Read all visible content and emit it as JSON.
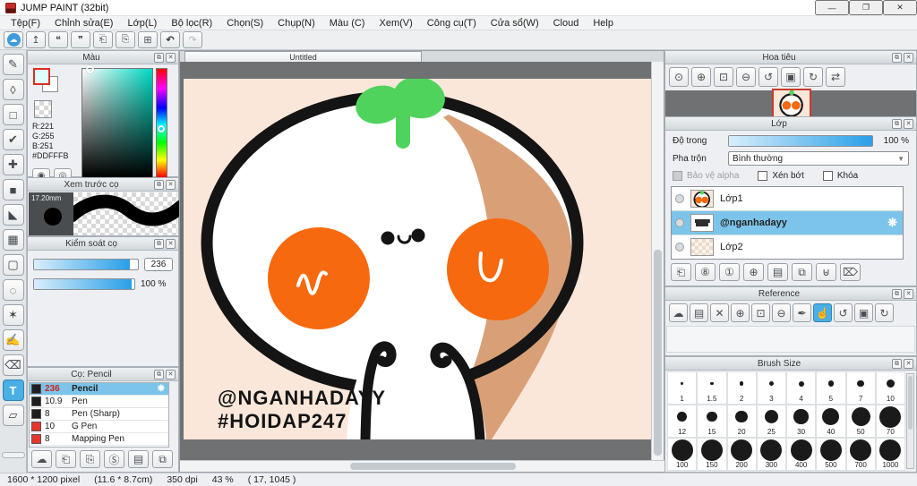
{
  "colors": {
    "artboard": "#FBE7DA",
    "outline": "#141414",
    "cheek": "#F7690E",
    "tan": "#D9A078",
    "sprout": "#4FD35C",
    "accent": "#49AFE4"
  },
  "window": {
    "title": "JUMP PAINT (32bit)",
    "controls": [
      {
        "name": "minimize-button",
        "glyph": "—"
      },
      {
        "name": "maximize-restore-button",
        "glyph": "❐"
      },
      {
        "name": "close-button",
        "glyph": "✕"
      }
    ]
  },
  "menu": {
    "items": [
      {
        "id": "menu-item-file",
        "label": "Tệp(F)"
      },
      {
        "id": "menu-item-edit",
        "label": "Chỉnh sửa(E)"
      },
      {
        "id": "menu-item-layer",
        "label": "Lớp(L)"
      },
      {
        "id": "menu-item-filter",
        "label": "Bộ lọc(R)"
      },
      {
        "id": "menu-item-select",
        "label": "Chọn(S)"
      },
      {
        "id": "menu-item-snap",
        "label": "Chụp(N)"
      },
      {
        "id": "menu-item-color",
        "label": "Màu (C)"
      },
      {
        "id": "menu-item-view",
        "label": "Xem(V)"
      },
      {
        "id": "menu-item-tools",
        "label": "Công cụ(T)"
      },
      {
        "id": "menu-item-window",
        "label": "Cửa sổ(W)"
      },
      {
        "id": "menu-item-cloud",
        "label": "Cloud"
      },
      {
        "id": "menu-item-help",
        "label": "Help"
      }
    ]
  },
  "toolbar": {
    "buttons": [
      {
        "name": "cloud-sync-button",
        "glyph": "☁",
        "blue": true
      },
      {
        "name": "publish-button",
        "glyph": "↥"
      },
      {
        "name": "comment-button",
        "glyph": "❝"
      },
      {
        "name": "comment-list-button",
        "glyph": "❞"
      },
      {
        "name": "document-button",
        "glyph": "⎗"
      },
      {
        "name": "document-settings-button",
        "glyph": "⎘"
      },
      {
        "name": "canvas-grid-button",
        "glyph": "⊞"
      },
      {
        "name": "undo-button",
        "glyph": "↶",
        "dark": true
      },
      {
        "name": "redo-button",
        "glyph": "↷",
        "muted": true
      }
    ]
  },
  "tools": {
    "items": [
      {
        "name": "brush-tool",
        "glyph": "✎"
      },
      {
        "name": "eraser-tool",
        "glyph": "◊"
      },
      {
        "name": "shape-brush-tool",
        "glyph": "□"
      },
      {
        "name": "control-point-tool",
        "glyph": "✔"
      },
      {
        "name": "move-tool",
        "glyph": "✚"
      },
      {
        "name": "fill-rect-tool",
        "glyph": "■"
      },
      {
        "name": "bucket-tool",
        "glyph": "◣"
      },
      {
        "name": "gradient-tool",
        "glyph": "▦"
      },
      {
        "name": "select-rect-tool",
        "glyph": "▢"
      },
      {
        "name": "lasso-tool",
        "glyph": "◌"
      },
      {
        "name": "magic-wand-tool",
        "glyph": "✶"
      },
      {
        "name": "select-pen-tool",
        "glyph": "✍"
      },
      {
        "name": "select-eraser-tool",
        "glyph": "⌫"
      },
      {
        "name": "text-tool",
        "glyph": "T",
        "active": true
      },
      {
        "name": "operation-tool",
        "glyph": "▱"
      }
    ]
  },
  "color_panel": {
    "title": "Màu",
    "r": "R:221",
    "g": "G:255",
    "b": "B:251",
    "hex": "#DDFFFB",
    "foreground": "#DDFFFB",
    "buttons": [
      {
        "name": "color-wheel-button",
        "glyph": "◉"
      },
      {
        "name": "color-compact-button",
        "glyph": "◎"
      }
    ]
  },
  "brush_preview": {
    "title": "Xem trước cọ",
    "size_label": "17.20mm"
  },
  "brush_control": {
    "title": "Kiểm soát cọ",
    "size_value": "236",
    "size_fill": "92%",
    "opacity_value": "100 %",
    "opacity_fill": "97%"
  },
  "brush_panel": {
    "title": "Cọ: Pencil",
    "brushes": [
      {
        "row": "brush-row-pencil",
        "size": "236",
        "name": "Pencil",
        "swatch": "#1E1E1E",
        "selected": true,
        "red_size": true,
        "gear": "❋"
      },
      {
        "row": "brush-row-pen",
        "size": "10.9",
        "name": "Pen",
        "swatch": "#1E1E1E"
      },
      {
        "row": "brush-row-pen-sharp",
        "size": "8",
        "name": "Pen (Sharp)",
        "swatch": "#1E1E1E"
      },
      {
        "row": "brush-row-g-pen",
        "size": "10",
        "name": "G Pen",
        "swatch": "#E8352B"
      },
      {
        "row": "brush-row-mapping-pen",
        "size": "8",
        "name": "Mapping Pen",
        "swatch": "#E8352B"
      }
    ],
    "footer": [
      {
        "name": "cloud-brush-button",
        "glyph": "☁"
      },
      {
        "name": "add-brush-button",
        "glyph": "⎗"
      },
      {
        "name": "add-brush-menu-button",
        "glyph": "⎘"
      },
      {
        "name": "script-brush-button",
        "glyph": "Ⓢ"
      },
      {
        "name": "brush-folder-button",
        "glyph": "▤"
      },
      {
        "name": "duplicate-brush-button",
        "glyph": "⧉"
      }
    ]
  },
  "canvas": {
    "tab": "Untitled",
    "watermark_line1": "@NGANHADAYY",
    "watermark_line2": "#HOIDAP247"
  },
  "navigator": {
    "title": "Hoa tiêu",
    "buttons": [
      {
        "name": "zoom-actual-button",
        "glyph": "⊙"
      },
      {
        "name": "zoom-in-button",
        "glyph": "⊕"
      },
      {
        "name": "zoom-fit-button",
        "glyph": "⊡"
      },
      {
        "name": "zoom-out-button",
        "glyph": "⊖"
      },
      {
        "name": "rotate-left-button",
        "glyph": "↺"
      },
      {
        "name": "rotate-reset-button",
        "glyph": "▣"
      },
      {
        "name": "rotate-right-button",
        "glyph": "↻"
      },
      {
        "name": "flip-horizontal-button",
        "glyph": "⇄"
      }
    ]
  },
  "layers_panel": {
    "title": "Lớp",
    "opacity_label": "Độ trong",
    "opacity_value": "100 %",
    "opacity_fill": "100%",
    "blend_label": "Pha trộn",
    "blend_value": "Bình thường",
    "cb_alpha": "Bảo vệ alpha",
    "cb_clip": "Xén bớt",
    "cb_lock": "Khóa",
    "layers": [
      {
        "row": "layer-row-lop1",
        "name": "Lớp1",
        "thumb": "face"
      },
      {
        "row": "layer-row-nganhadayy",
        "name": "@nganhadayy",
        "thumb": "text",
        "selected": true,
        "gear": "❋"
      },
      {
        "row": "layer-row-lop2",
        "name": "Lớp2",
        "thumb": "checker"
      }
    ],
    "footer": [
      {
        "name": "add-layer-button",
        "glyph": "⎗"
      },
      {
        "name": "add-8bit-layer-button",
        "glyph": "⑧"
      },
      {
        "name": "add-1bit-layer-button",
        "glyph": "①"
      },
      {
        "name": "add-layer-menu-button",
        "glyph": "⊕"
      },
      {
        "name": "new-layer-folder-button",
        "glyph": "▤"
      },
      {
        "name": "duplicate-layer-button",
        "glyph": "⧉"
      },
      {
        "name": "merge-layer-button",
        "glyph": "⊎"
      },
      {
        "name": "delete-layer-button",
        "glyph": "⌦"
      }
    ]
  },
  "reference_panel": {
    "title": "Reference",
    "buttons": [
      {
        "name": "cloud-open-button",
        "glyph": "☁"
      },
      {
        "name": "folder-open-button",
        "glyph": "▤"
      },
      {
        "name": "clear-button",
        "glyph": "✕"
      },
      {
        "name": "zoom-in-button",
        "glyph": "⊕"
      },
      {
        "name": "zoom-fit-button",
        "glyph": "⊡"
      },
      {
        "name": "zoom-out-button",
        "glyph": "⊖"
      },
      {
        "name": "eyedropper-button",
        "glyph": "✒"
      },
      {
        "name": "hand-button",
        "glyph": "☝",
        "active": true
      },
      {
        "name": "rotate-left-button",
        "glyph": "↺"
      },
      {
        "name": "rotate-reset-button",
        "glyph": "▣"
      },
      {
        "name": "rotate-right-button",
        "glyph": "↻"
      }
    ]
  },
  "brush_size_panel": {
    "title": "Brush Size",
    "sizes": [
      1,
      1.5,
      2,
      3,
      4,
      5,
      7,
      10,
      12,
      15,
      20,
      25,
      30,
      40,
      50,
      70,
      100,
      150,
      200,
      300,
      400,
      500,
      700,
      1000
    ]
  },
  "status_bar": {
    "dimensions": "1600 * 1200 pixel",
    "size_cm": "(11.6 * 8.7cm)",
    "dpi": "350 dpi",
    "zoom": "43 %",
    "coords": "( 17, 1045 )"
  }
}
